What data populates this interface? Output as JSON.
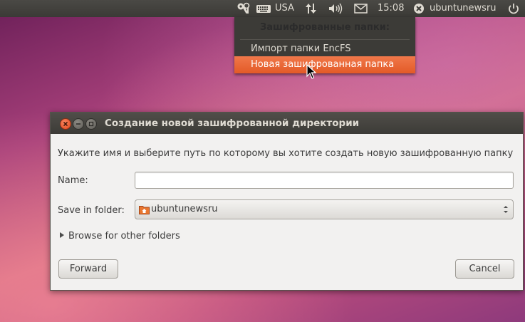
{
  "panel": {
    "keyboard_layout": "USA",
    "time": "15:08",
    "user": "ubuntunewsru",
    "icons": [
      "encfs-keys-icon",
      "keyboard-icon",
      "network-icon",
      "volume-icon",
      "mail-icon",
      "user-icon",
      "power-icon"
    ]
  },
  "menu": {
    "header": "Зашифрованные папки:",
    "items": [
      {
        "label": "Импорт папки EncFS"
      },
      {
        "label": "Новая зашифрованная папка"
      }
    ]
  },
  "dialog": {
    "title": "Создание новой зашифрованной директории",
    "instruction": "Укажите имя и выберите путь по которому вы хотите создать новую зашифрованную папку",
    "name_label": "Name:",
    "name_value": "",
    "folder_label": "Save in folder:",
    "folder_value": "ubuntunewsru",
    "browse_label": "Browse for other folders",
    "forward_label": "Forward",
    "cancel_label": "Cancel"
  },
  "colors": {
    "panel_bg": "#3c3b37",
    "menu_highlight": "#e8612e",
    "close_button": "#e0461a"
  }
}
